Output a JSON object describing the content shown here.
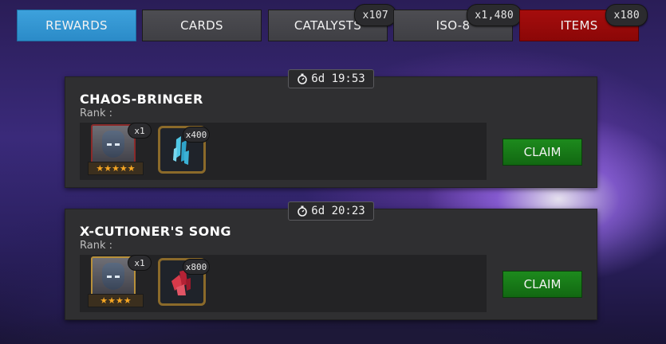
{
  "tabs": [
    {
      "label": "REWARDS",
      "active": true
    },
    {
      "label": "CARDS"
    },
    {
      "label": "CATALYSTS",
      "count": "x107"
    },
    {
      "label": "ISO-8",
      "count": "x1,480"
    },
    {
      "label": "ITEMS",
      "count": "x180"
    }
  ],
  "colors": {
    "tab_active": "#2b8bc8",
    "tab_items": "#8b0707",
    "claim_button": "#126812",
    "star": "#f5a623"
  },
  "rewards": [
    {
      "timer": "6d 19:53",
      "title": "CHAOS-BRINGER",
      "rank_label": "Rank :",
      "hero": {
        "stars": "★★★★★",
        "quantity": "x1",
        "star_count": 5,
        "icon": "hero-portrait-icon"
      },
      "item": {
        "quantity": "x400",
        "icon": "cyan-crystal-shards-icon"
      },
      "claim_label": "CLAIM"
    },
    {
      "timer": "6d 20:23",
      "title": "X-CUTIONER'S SONG",
      "rank_label": "Rank :",
      "hero": {
        "stars": "★★★★",
        "quantity": "x1",
        "star_count": 4,
        "icon": "hero-portrait-icon"
      },
      "item": {
        "quantity": "x800",
        "icon": "red-crystal-shards-icon"
      },
      "claim_label": "CLAIM"
    }
  ]
}
